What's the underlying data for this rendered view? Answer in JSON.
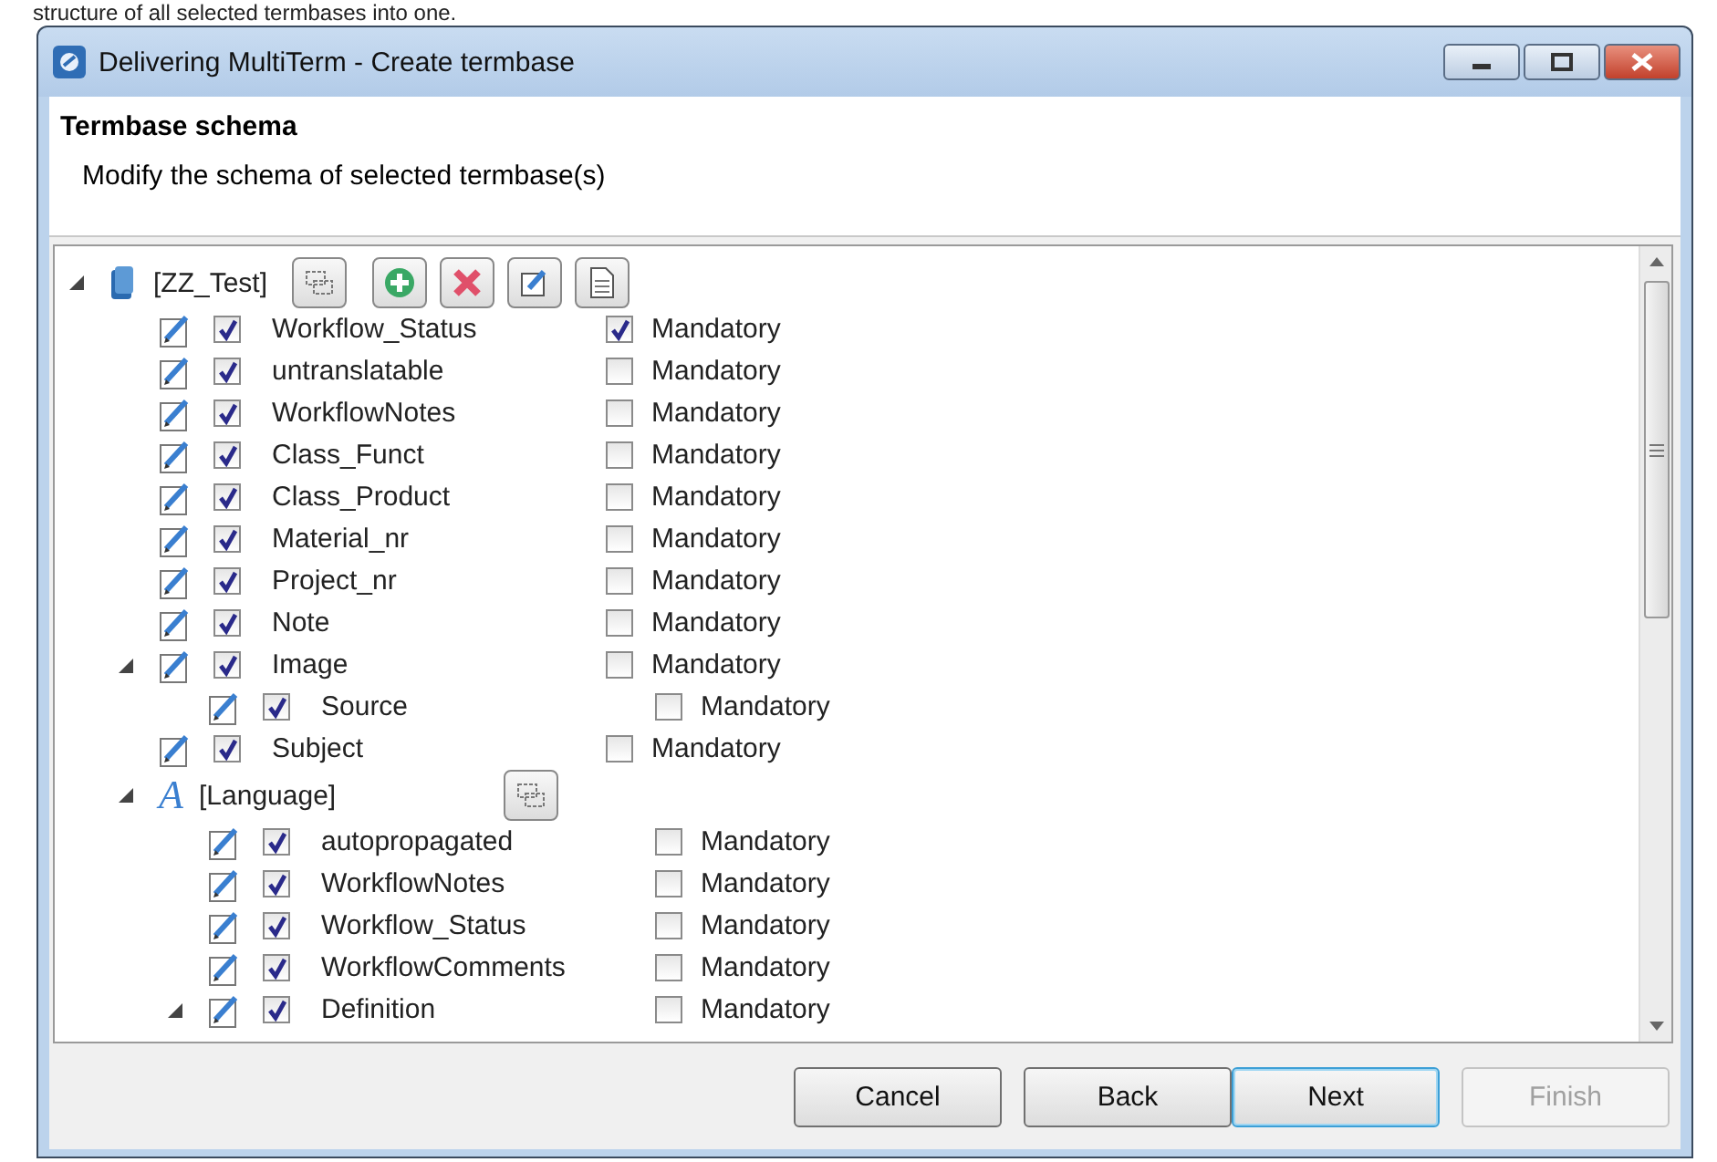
{
  "background_text": "structure of all selected termbases into one.",
  "window": {
    "title": "Delivering MultiTerm - Create termbase"
  },
  "header": {
    "title": "Termbase schema",
    "subtitle": "Modify the schema of selected termbase(s)"
  },
  "tree": [
    {
      "kind": "termbase",
      "label": "[ZZ_Test]",
      "expanded": true,
      "children": [
        {
          "kind": "field",
          "label": "Workflow_Status",
          "enabled": true,
          "mandatory": true,
          "mandatory_label": "Mandatory"
        },
        {
          "kind": "field",
          "label": "untranslatable",
          "enabled": true,
          "mandatory": false,
          "mandatory_label": "Mandatory"
        },
        {
          "kind": "field",
          "label": "WorkflowNotes",
          "enabled": true,
          "mandatory": false,
          "mandatory_label": "Mandatory"
        },
        {
          "kind": "field",
          "label": "Class_Funct",
          "enabled": true,
          "mandatory": false,
          "mandatory_label": "Mandatory"
        },
        {
          "kind": "field",
          "label": "Class_Product",
          "enabled": true,
          "mandatory": false,
          "mandatory_label": "Mandatory"
        },
        {
          "kind": "field",
          "label": "Material_nr",
          "enabled": true,
          "mandatory": false,
          "mandatory_label": "Mandatory"
        },
        {
          "kind": "field",
          "label": "Project_nr",
          "enabled": true,
          "mandatory": false,
          "mandatory_label": "Mandatory"
        },
        {
          "kind": "field",
          "label": "Note",
          "enabled": true,
          "mandatory": false,
          "mandatory_label": "Mandatory"
        },
        {
          "kind": "field",
          "label": "Image",
          "enabled": true,
          "mandatory": false,
          "mandatory_label": "Mandatory",
          "expanded": true,
          "children": [
            {
              "kind": "field",
              "label": "Source",
              "enabled": true,
              "mandatory": false,
              "mandatory_label": "Mandatory"
            }
          ]
        },
        {
          "kind": "field",
          "label": "Subject",
          "enabled": true,
          "mandatory": false,
          "mandatory_label": "Mandatory"
        },
        {
          "kind": "language",
          "icon_text": "A",
          "label": "[Language]",
          "expanded": true,
          "children": [
            {
              "kind": "field",
              "label": "autopropagated",
              "enabled": true,
              "mandatory": false,
              "mandatory_label": "Mandatory"
            },
            {
              "kind": "field",
              "label": "WorkflowNotes",
              "enabled": true,
              "mandatory": false,
              "mandatory_label": "Mandatory"
            },
            {
              "kind": "field",
              "label": "Workflow_Status",
              "enabled": true,
              "mandatory": false,
              "mandatory_label": "Mandatory"
            },
            {
              "kind": "field",
              "label": "WorkflowComments",
              "enabled": true,
              "mandatory": false,
              "mandatory_label": "Mandatory"
            },
            {
              "kind": "field",
              "label": "Definition",
              "enabled": true,
              "mandatory": false,
              "mandatory_label": "Mandatory",
              "expanded": true
            }
          ]
        }
      ]
    }
  ],
  "buttons": [
    {
      "label": "Cancel",
      "focused": false,
      "disabled": false
    },
    {
      "label": "Back",
      "focused": false,
      "disabled": false
    },
    {
      "label": "Next",
      "focused": true,
      "disabled": false
    },
    {
      "label": "Finish",
      "focused": false,
      "disabled": true
    }
  ]
}
